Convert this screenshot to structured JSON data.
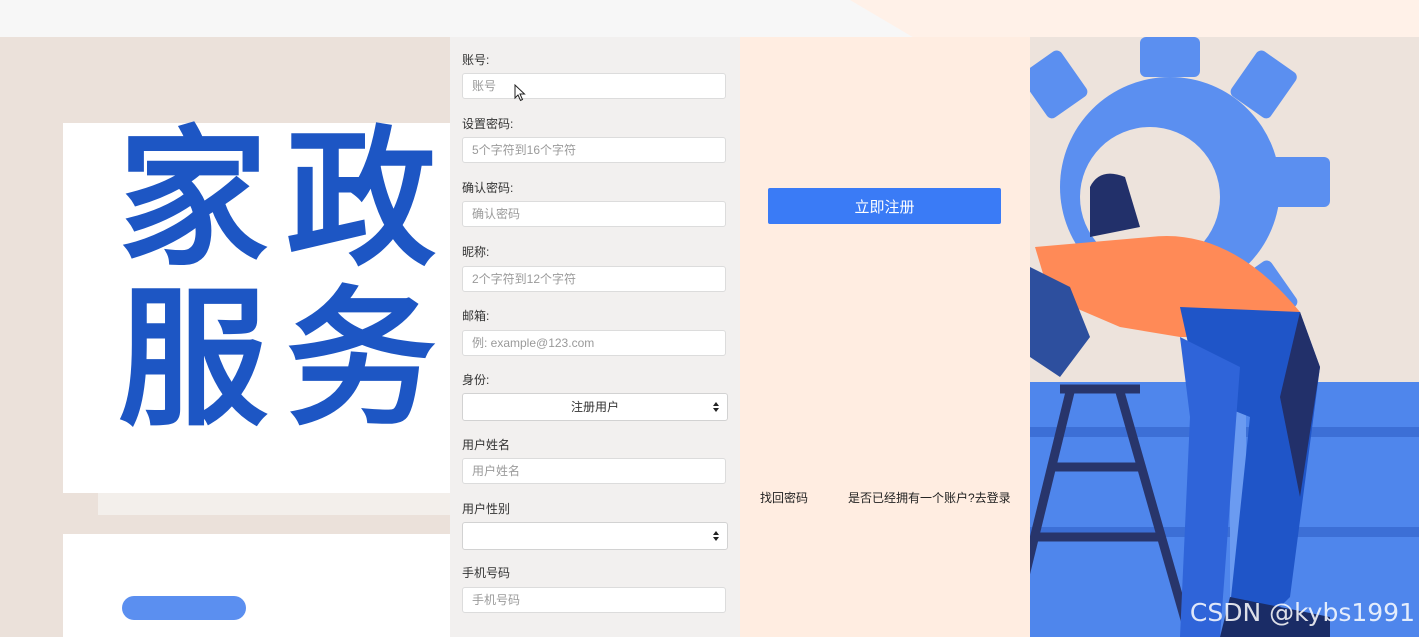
{
  "banner": {
    "line1": "家政",
    "line2": "服务"
  },
  "form": {
    "account": {
      "label": "账号:",
      "placeholder": "账号"
    },
    "password": {
      "label": "设置密码:",
      "placeholder": "5个字符到16个字符"
    },
    "confirm": {
      "label": "确认密码:",
      "placeholder": "确认密码"
    },
    "nickname": {
      "label": "昵称:",
      "placeholder": "2个字符到12个字符"
    },
    "email": {
      "label": "邮箱:",
      "placeholder": "例: example@123.com"
    },
    "identity": {
      "label": "身份:",
      "value": "注册用户"
    },
    "realname": {
      "label": "用户姓名",
      "placeholder": "用户姓名"
    },
    "gender": {
      "label": "用户性别",
      "value": ""
    },
    "phone": {
      "label": "手机号码",
      "placeholder": "手机号码"
    }
  },
  "actions": {
    "register_label": "立即注册",
    "find_password": "找回密码",
    "go_login": "是否已经拥有一个账户?去登录"
  },
  "watermark": "CSDN @kybs1991",
  "colors": {
    "accent": "#3a7bf6",
    "banner_text": "#1d56c4",
    "form_bg": "#f2f0ef",
    "panel_bg": "#ffede1"
  },
  "icons": [
    "mouse-pointer-icon",
    "select-arrows-icon",
    "gear-illustration",
    "worker-illustration",
    "ladder-illustration"
  ]
}
